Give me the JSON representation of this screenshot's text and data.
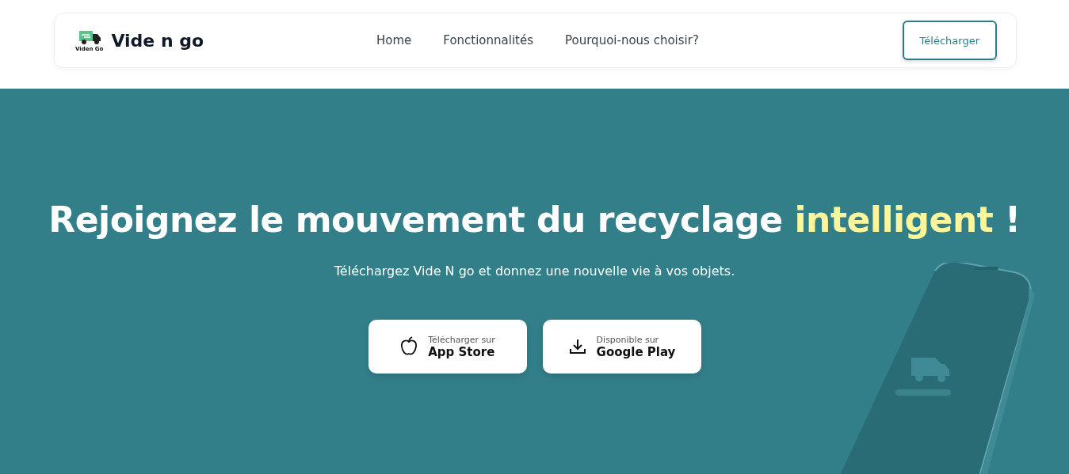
{
  "navbar": {
    "logo_caption": "Viden Go",
    "brand": "Vide n go",
    "links": [
      {
        "label": "Home"
      },
      {
        "label": "Fonctionnalités"
      },
      {
        "label": "Pourquoi-nous choisir?"
      }
    ],
    "cta": "Télécharger"
  },
  "hero": {
    "title_parts": [
      {
        "text": "Rejoignez le mouvement du recyclage ",
        "highlight": false
      },
      {
        "text": "intelligent",
        "highlight": true
      },
      {
        "text": " !",
        "highlight": false
      }
    ],
    "subtitle": "Téléchargez Vide N go et donnez une nouvelle vie à vos objets.",
    "store_buttons": [
      {
        "kind": "apple",
        "small": "Télécharger sur",
        "big": "App Store"
      },
      {
        "kind": "download",
        "small": "Disponible sur",
        "big": "Google Play"
      }
    ]
  }
}
